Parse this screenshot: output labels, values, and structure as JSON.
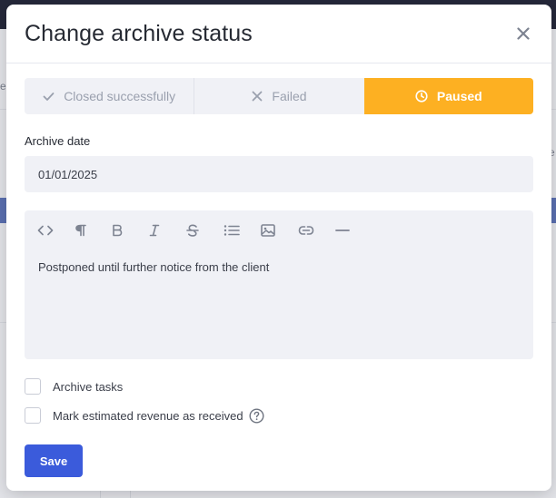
{
  "background": {
    "edge_left_text": "e",
    "edge_right_text": "j\ne"
  },
  "modal": {
    "title": "Change archive status",
    "close_icon": "close-icon"
  },
  "status_options": [
    {
      "label": "Closed successfully",
      "icon": "check-icon",
      "active": false
    },
    {
      "label": "Failed",
      "icon": "x-icon",
      "active": false
    },
    {
      "label": "Paused",
      "icon": "clock-icon",
      "active": true
    }
  ],
  "archive_date": {
    "label": "Archive date",
    "value": "01/01/2025"
  },
  "editor": {
    "toolbar": [
      "code-icon",
      "paragraph-icon",
      "bold-icon",
      "italic-icon",
      "strikethrough-icon",
      "bullet-list-icon",
      "image-icon",
      "link-icon",
      "horizontal-rule-icon"
    ],
    "content": "Postponed until further notice from the client"
  },
  "options": {
    "archive_tasks_label": "Archive tasks",
    "archive_tasks_checked": false,
    "mark_revenue_label": "Mark estimated revenue as received",
    "mark_revenue_checked": false,
    "help_icon": "question-circle-icon"
  },
  "actions": {
    "save_label": "Save"
  },
  "colors": {
    "accent_active": "#fdb022",
    "primary_button": "#3b5bdb",
    "field_bg": "#f0f1f6"
  }
}
